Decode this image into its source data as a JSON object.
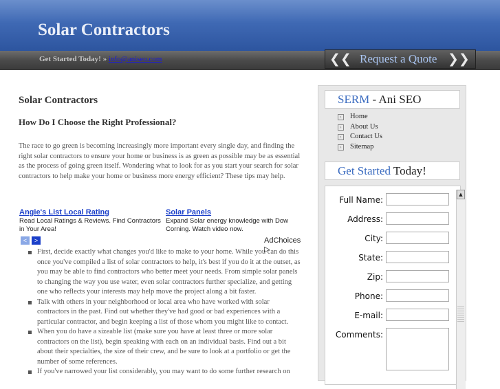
{
  "header": {
    "title": "Solar Contractors"
  },
  "topbar": {
    "get_started_text": "Get Started Today! » ",
    "email_link": "info@aniseo.com",
    "quote_button": "Request a Quote",
    "chevron_left": "❮❮",
    "chevron_right": "❯❯"
  },
  "main": {
    "title": "Solar Contractors",
    "subtitle": "How Do I Choose the Right Professional?",
    "intro": "The race to go green is becoming increasingly more important every single day, and finding the right solar contractors to ensure your home or business is as green as possible may be as essential as the process of going green itself. Wondering what to look for as you start your search for solar contractors to help make your home or business more energy efficient? These tips may help.",
    "tips": [
      "First, decide exactly what changes you'd like to make to your home. While you can do this once you've compiled a list of solar contractors to help, it's best if you do it at the outset, as you may be able to find contractors who better meet your needs. From simple solar panels to changing the way you use water, even solar contractors further specialize, and getting one who reflects your interests may help move the project along a bit faster.",
      "Talk with others in your neighborhood or local area who have worked with solar contractors in the past. Find out whether they've had good or bad experiences with a particular contractor, and begin keeping a list of those whom you might like to contact.",
      "When you do have a sizeable list (make sure you have at least three or more solar contractors on the list), begin speaking with each on an individual basis. Find out a bit about their specialties, the size of their crew, and be sure to look at a portfolio or get the number of some references.",
      "If you've narrowed your list considerably, you may want to do some further research on"
    ]
  },
  "ads": {
    "items": [
      {
        "title": "Angie's List Local Rating",
        "text": "Read Local Ratings & Reviews. Find Contractors in Your Area!"
      },
      {
        "title": "Solar Panels",
        "text": "Expand Solar energy knowledge with Dow Corning. Watch video now."
      }
    ],
    "prev": "<",
    "next": ">",
    "adchoices": "AdChoices ▷"
  },
  "sidebar": {
    "serm_highlight": "SERM",
    "serm_rest": " - Ani SEO",
    "nav": [
      "Home",
      "About Us",
      "Contact Us",
      "Sitemap"
    ],
    "get_started_highlight": "Get Started",
    "get_started_rest": " Today!",
    "form_fields": [
      "Full Name:",
      "Address:",
      "City:",
      "State:",
      "Zip:",
      "Phone:",
      "E-mail:",
      "Comments:"
    ]
  },
  "colors": {
    "header_blue": "#3f69b4",
    "accent_blue": "#3b6cc0",
    "link_blue": "#1a3fc9"
  }
}
